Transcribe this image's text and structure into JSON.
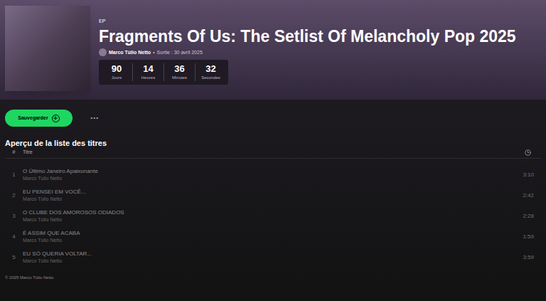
{
  "album": {
    "type": "EP",
    "title": "Fragments Of Us: The Setlist Of Melancholy Pop 2025",
    "artist": "Marco Túlio Netto",
    "separator": "•",
    "release": "Sortie : 30 avril 2025"
  },
  "countdown": [
    {
      "value": "90",
      "unit": "Jours"
    },
    {
      "value": "14",
      "unit": "Heures"
    },
    {
      "value": "36",
      "unit": "Minutes"
    },
    {
      "value": "32",
      "unit": "Secondes"
    }
  ],
  "actions": {
    "save": "Sauvegarder",
    "more": "···"
  },
  "tracklist": {
    "heading": "Aperçu de la liste des titres",
    "columns": [
      "#",
      "Titre"
    ],
    "tracks": [
      {
        "number": "1",
        "title": "O Último Janeiro Apaixonante",
        "artist": "Marco Túlio Netto",
        "duration": "3:10",
        "disabled": true
      },
      {
        "number": "2",
        "title": "EU PENSEI EM VOCÊ...",
        "artist": "Marco Túlio Netto",
        "duration": "2:42",
        "disabled": true
      },
      {
        "number": "3",
        "title": "O CLUBE DOS AMOROSOS ODIADOS",
        "artist": "Marco Túlio Netto",
        "duration": "2:28",
        "disabled": true
      },
      {
        "number": "4",
        "title": "É ASSIM QUE ACABA",
        "artist": "Marco Túlio Netto",
        "duration": "1:59",
        "disabled": true
      },
      {
        "number": "5",
        "title": "EU SÓ QUERIA VOLTAR...",
        "artist": "Marco Túlio Netto",
        "duration": "3:59",
        "disabled": true
      }
    ]
  },
  "footer": "© 2025 Marco Túlio Netto"
}
